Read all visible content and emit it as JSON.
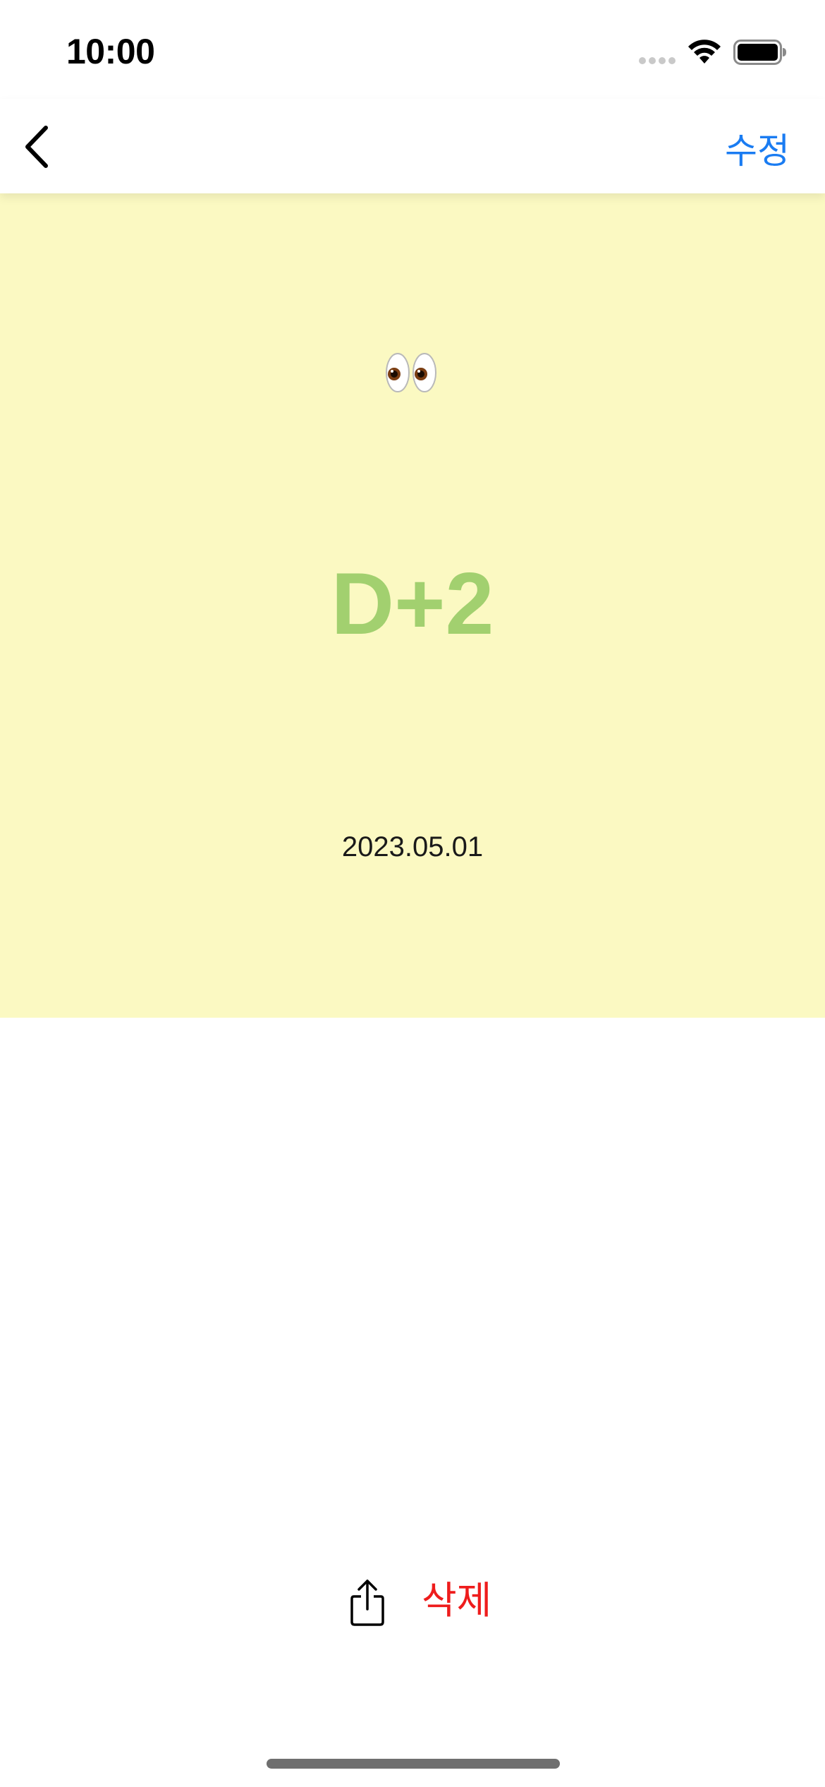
{
  "status_bar": {
    "time": "10:00"
  },
  "nav": {
    "edit_label": "수정",
    "back_icon": "chevron-left-icon"
  },
  "card": {
    "emoji": "👀",
    "dday": "D+2",
    "date": "2023.05.01",
    "background_color": "#fbf9c2",
    "dday_color": "#a2d06f"
  },
  "toolbar": {
    "share_icon": "share-icon",
    "delete_label": "삭제",
    "delete_color": "#ee1c1c"
  },
  "colors": {
    "accent": "#1a7cf2"
  }
}
